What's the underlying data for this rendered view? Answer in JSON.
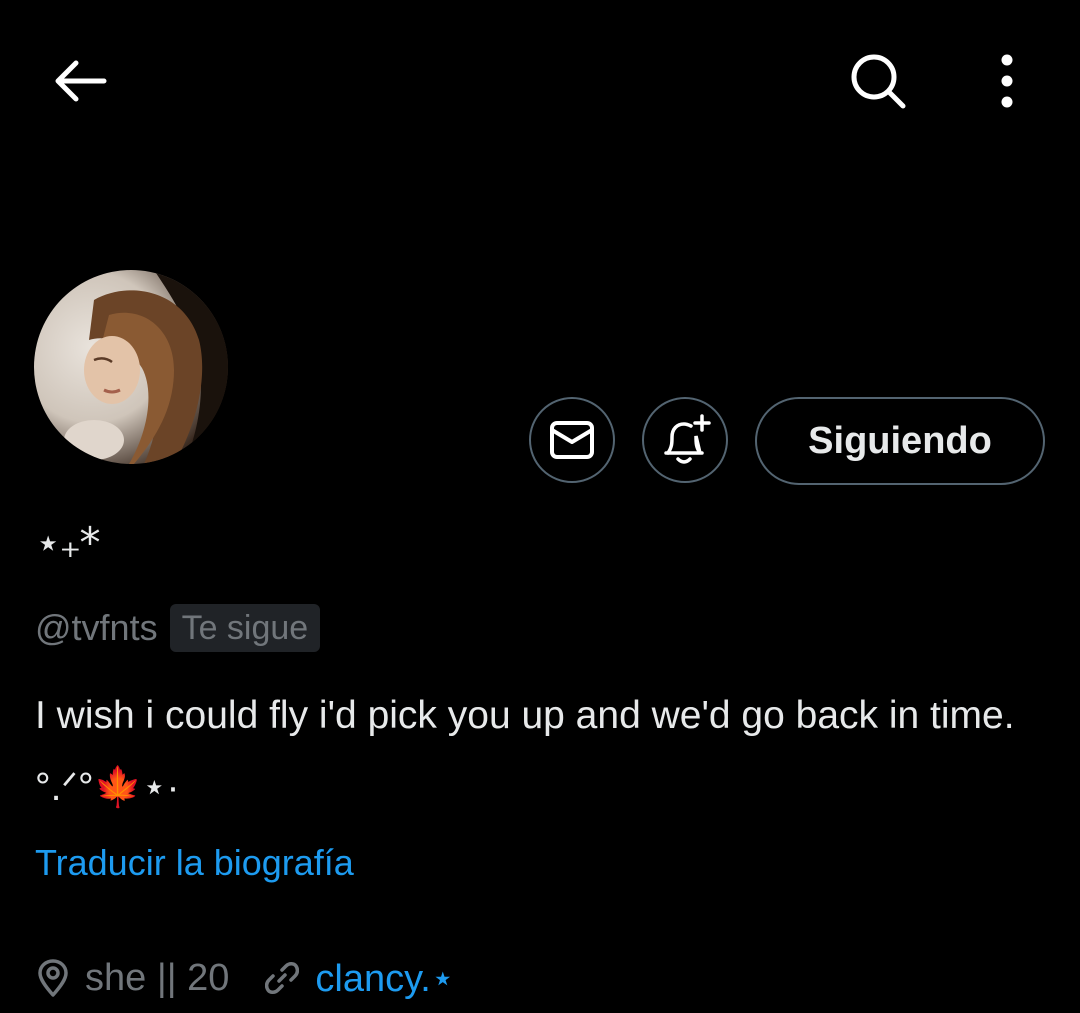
{
  "topbar": {
    "back_icon": "arrow-left-icon",
    "search_icon": "search-icon",
    "more_icon": "more-vertical-icon"
  },
  "profile": {
    "display_name": "⋆₊*",
    "handle": "@tvfnts",
    "follows_you": "Te sigue",
    "bio": "I wish i could fly i'd pick you up and we'd go back in time. °.ᐟ°🍁⋆·",
    "translate_label": "Traducir la biografía",
    "location": "she || 20",
    "link": "clancy.⋆"
  },
  "actions": {
    "message_icon": "envelope-icon",
    "notify_icon": "bell-plus-icon",
    "following_label": "Siguiendo"
  },
  "colors": {
    "background": "#000000",
    "text": "#e7e9ea",
    "muted": "#71767b",
    "accent": "#1d9bf0",
    "border": "#536471"
  }
}
